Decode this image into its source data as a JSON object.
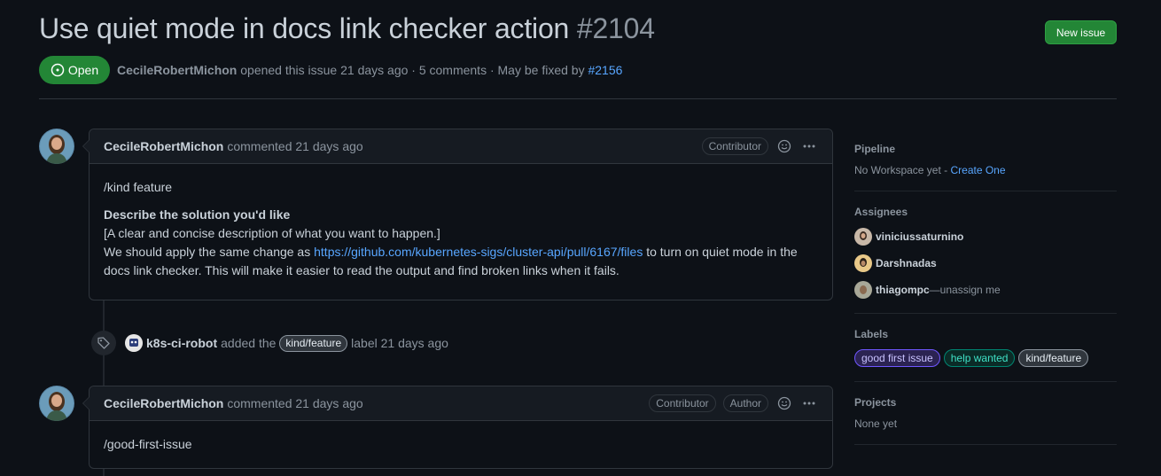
{
  "issue": {
    "title": "Use quiet mode in docs link checker action",
    "number": "#2104",
    "state": "Open",
    "author": "CecileRobertMichon",
    "opened_text": "opened this issue 21 days ago · 5 comments · May be fixed by",
    "fixed_by": "#2156"
  },
  "header": {
    "new_issue_label": "New issue"
  },
  "comments": [
    {
      "author": "CecileRobertMichon",
      "meta": "commented 21 days ago",
      "badges": [
        "Contributor"
      ],
      "body": {
        "line1": "/kind feature",
        "heading": "Describe the solution you'd like",
        "line2": "[A clear and concise description of what you want to happen.]",
        "line3_pre": "We should apply the same change as",
        "link": "https://github.com/kubernetes-sigs/cluster-api/pull/6167/files",
        "line3_post": "to turn on quiet mode in the",
        "line4": "docs link checker. This will make it easier to read the output and find broken links when it fails."
      }
    },
    {
      "author": "CecileRobertMichon",
      "meta": "commented 21 days ago",
      "badges": [
        "Contributor",
        "Author"
      ],
      "body": {
        "line1": "/good-first-issue"
      }
    }
  ],
  "event": {
    "actor": "k8s-ci-robot",
    "pre": "added the",
    "label": "kind/feature",
    "post": "label 21 days ago"
  },
  "sidebar": {
    "pipeline": {
      "heading": "Pipeline",
      "text": "No Workspace yet -",
      "link": "Create One"
    },
    "assignees": {
      "heading": "Assignees",
      "people": [
        "viniciussaturnino",
        "Darshnadas",
        "thiagompc"
      ],
      "unassign": "—unassign me"
    },
    "labels": {
      "heading": "Labels",
      "items": [
        "good first issue",
        "help wanted",
        "kind/feature"
      ]
    },
    "projects": {
      "heading": "Projects",
      "text": "None yet"
    }
  },
  "colors": {
    "background": "#0d1117",
    "open_green": "#238636",
    "link_blue": "#58a6ff",
    "label_good_first": "#7057ff",
    "label_help_wanted": "#008672",
    "label_kind_feature": "#c7def8"
  },
  "icons": [
    "issue-opened-icon",
    "smiley-icon",
    "kebab-horizontal-icon",
    "tag-icon"
  ]
}
